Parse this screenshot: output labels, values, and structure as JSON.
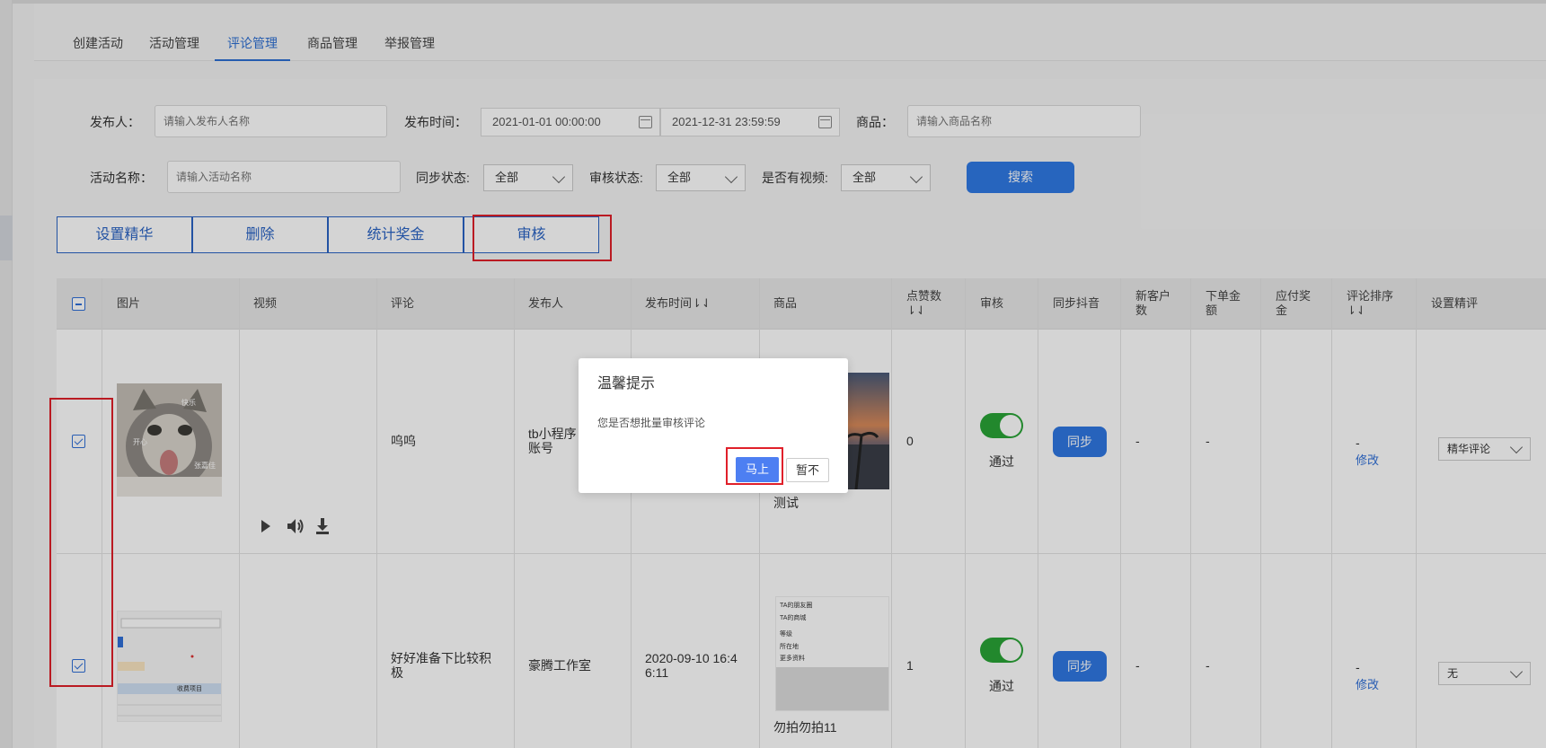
{
  "tabs": [
    "创建活动",
    "活动管理",
    "评论管理",
    "商品管理",
    "举报管理"
  ],
  "filters": {
    "publisher_label": "发布人：",
    "publisher_placeholder": "请输入发布人名称",
    "time_label": "发布时间：",
    "start_date": "2021-01-01 00:00:00",
    "end_date": "2021-12-31 23:59:59",
    "product_label": "商品：",
    "product_placeholder": "请输入商品名称",
    "activity_label": "活动名称：",
    "activity_placeholder": "请输入活动名称",
    "sync_label": "同步状态:",
    "sync_value": "全部",
    "review_label": "审核状态:",
    "review_value": "全部",
    "video_label": "是否有视频:",
    "video_value": "全部",
    "search_button": "搜索"
  },
  "actions": [
    "设置精华",
    "删除",
    "统计奖金",
    "审核"
  ],
  "table": {
    "headers": [
      "图片",
      "视频",
      "评论",
      "发布人",
      "发布时间⇂⇃",
      "商品",
      "点赞数",
      "⇂⇃",
      "审核",
      "同步抖音",
      "新客户",
      "数",
      "下单金",
      "额",
      "应付奖",
      "金",
      "评论排序",
      "⇂⇃",
      "设置精评"
    ],
    "rows": [
      {
        "comment": "呜呜",
        "publisher_l1": "tb小程序",
        "publisher_l2": "账号",
        "product_name": "测试",
        "likes": "0",
        "review": "通过",
        "sync": "同步",
        "new_customers": "-",
        "order_amount": "-",
        "sort_value": "-",
        "sort_edit": "修改",
        "featured": "精华评论",
        "cat_text1": "快乐",
        "cat_text2": "开心",
        "cat_text3": "张嘉佳"
      },
      {
        "comment_l1": "好好准备下比较积",
        "comment_l2": "极",
        "publisher": "豪腾工作室",
        "time_l1": "2020-09-10 16:4",
        "time_l2": "6:11",
        "product_name": "勿拍勿拍11",
        "likes": "1",
        "review": "通过",
        "sync": "同步",
        "new_customers": "-",
        "order_amount": "-",
        "sort_value": "-",
        "sort_edit": "修改",
        "featured": "无",
        "shot_text1": "TA的朋友圈",
        "shot_text2": "TA的商城",
        "shot_text3": "等级",
        "shot_text4": "所在地",
        "shot_text5": "更多资料",
        "shot_text6": "收费项目"
      }
    ]
  },
  "dialog": {
    "title": "温馨提示",
    "message": "您是否想批量审核评论",
    "confirm": "马上",
    "cancel": "暂不"
  },
  "colors": {
    "accent": "#2f7ae5",
    "highlight": "#e0202a",
    "toggle_on": "#2aa437"
  }
}
